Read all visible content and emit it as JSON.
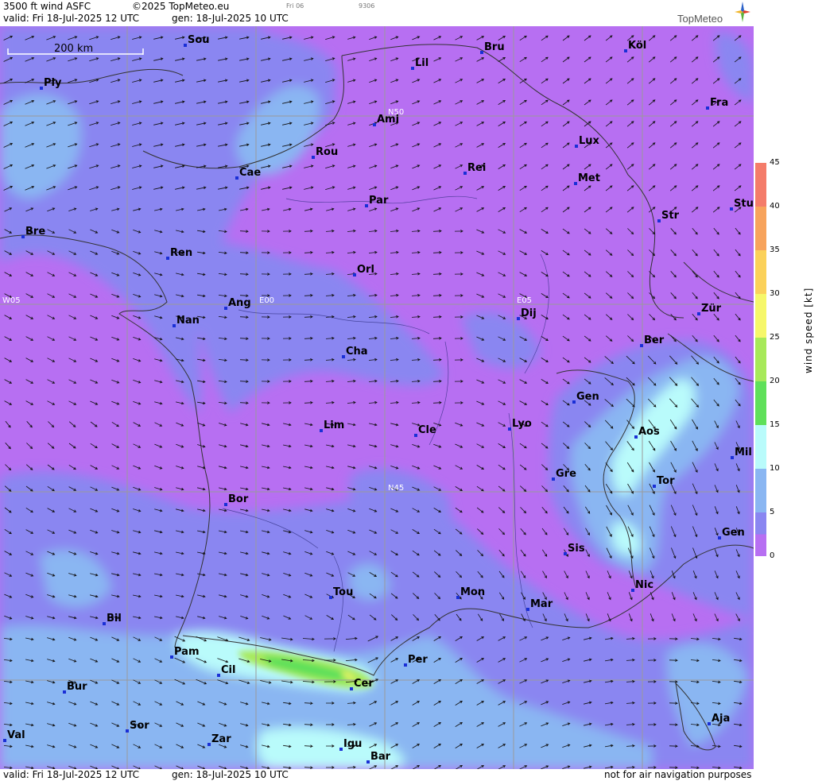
{
  "header": {
    "product": "3500 ft wind ASFC",
    "copyright": "©2025 TopMeteo.eu",
    "valid": "valid:  Fri  18-Jul-2025  12 UTC",
    "generated": "gen: 18-Jul-2025 10 UTC",
    "tiny_day": "Fri 06",
    "tiny_code": "9306",
    "logo": "TopMeteo"
  },
  "footer": {
    "valid": "valid:  Fri  18-Jul-2025  12 UTC",
    "generated": "gen: 18-Jul-2025 10 UTC",
    "disclaimer": "not for air navigation purposes"
  },
  "scale_bar": "200 km",
  "legend": {
    "title": "wind  speed  [kt]",
    "ticks": [
      "45",
      "40",
      "35",
      "30",
      "25",
      "20",
      "15",
      "10",
      "5",
      "0"
    ],
    "colors": [
      "#f47c6a",
      "#f7a35c",
      "#fbd15a",
      "#f6f76a",
      "#a7e95a",
      "#5fe05a",
      "#b9fbfb",
      "#9fdcf6",
      "#8ab6f2",
      "#8a86f1",
      "#b76ff2"
    ]
  },
  "coords": [
    "N50",
    "N45",
    "W05",
    "E00",
    "E05"
  ],
  "cities": [
    {
      "name": "Sou"
    },
    {
      "name": "Bru"
    },
    {
      "name": "Köl"
    },
    {
      "name": "Lil"
    },
    {
      "name": "Ply"
    },
    {
      "name": "Ami"
    },
    {
      "name": "Fra"
    },
    {
      "name": "Lux"
    },
    {
      "name": "Rou"
    },
    {
      "name": "Cae"
    },
    {
      "name": "Rei"
    },
    {
      "name": "Met"
    },
    {
      "name": "Par"
    },
    {
      "name": "Stu"
    },
    {
      "name": "Bre"
    },
    {
      "name": "Str"
    },
    {
      "name": "Ren"
    },
    {
      "name": "Orl"
    },
    {
      "name": "Ang"
    },
    {
      "name": "Dij"
    },
    {
      "name": "Zür"
    },
    {
      "name": "Nan"
    },
    {
      "name": "Ber"
    },
    {
      "name": "Cha"
    },
    {
      "name": "Gen"
    },
    {
      "name": "Aos"
    },
    {
      "name": "Lim"
    },
    {
      "name": "Cle"
    },
    {
      "name": "Lyo"
    },
    {
      "name": "Mil"
    },
    {
      "name": "Gre"
    },
    {
      "name": "Tor"
    },
    {
      "name": "Bor"
    },
    {
      "name": "Sis"
    },
    {
      "name": "Gen"
    },
    {
      "name": "Tou"
    },
    {
      "name": "Mon"
    },
    {
      "name": "Nic"
    },
    {
      "name": "Mar"
    },
    {
      "name": "Bil"
    },
    {
      "name": "Pam"
    },
    {
      "name": "Cil"
    },
    {
      "name": "Per"
    },
    {
      "name": "Cer"
    },
    {
      "name": "Bur"
    },
    {
      "name": "Aja"
    },
    {
      "name": "Sor"
    },
    {
      "name": "Val"
    },
    {
      "name": "Zar"
    },
    {
      "name": "Igu"
    },
    {
      "name": "Bar"
    }
  ]
}
